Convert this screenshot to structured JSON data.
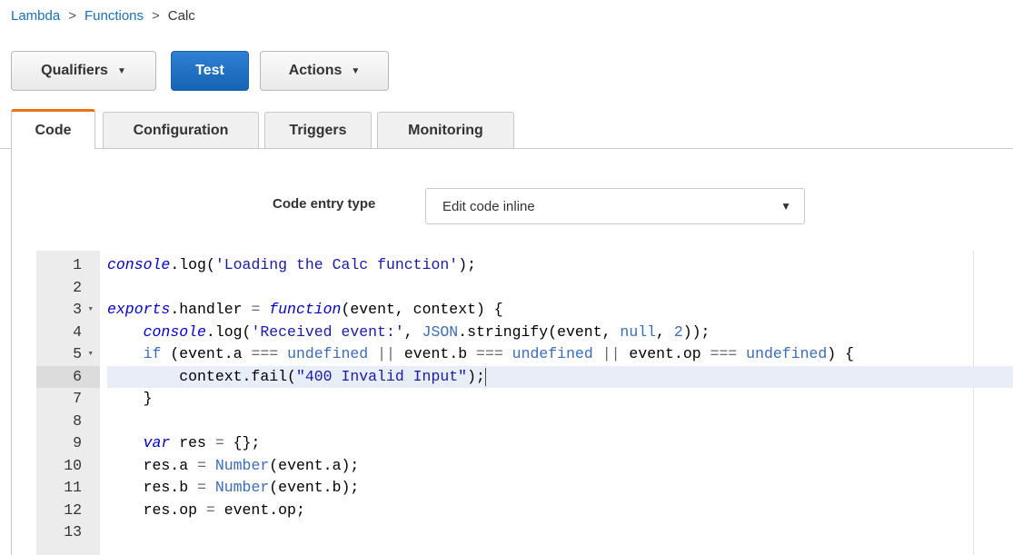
{
  "breadcrumb": {
    "items": [
      "Lambda",
      "Functions"
    ],
    "current": "Calc",
    "separator": ">"
  },
  "toolbar": {
    "qualifiers_label": "Qualifiers",
    "test_label": "Test",
    "actions_label": "Actions"
  },
  "tabs": {
    "code": "Code",
    "configuration": "Configuration",
    "triggers": "Triggers",
    "monitoring": "Monitoring",
    "active": "Code"
  },
  "code_entry": {
    "label": "Code entry type",
    "selected": "Edit code inline"
  },
  "editor": {
    "active_line": 6,
    "lines": [
      {
        "n": "1",
        "fold": false,
        "tokens": [
          [
            "kw",
            "console"
          ],
          [
            "",
            "."
          ],
          [
            "",
            "log"
          ],
          [
            "",
            "("
          ],
          [
            "str",
            "'Loading the Calc function'"
          ],
          [
            "",
            ");"
          ]
        ]
      },
      {
        "n": "2",
        "fold": false,
        "tokens": []
      },
      {
        "n": "3",
        "fold": true,
        "tokens": [
          [
            "kw",
            "exports"
          ],
          [
            "",
            ".handler "
          ],
          [
            "op",
            "="
          ],
          [
            "",
            " "
          ],
          [
            "kw",
            "function"
          ],
          [
            "",
            "(event, context) {"
          ]
        ]
      },
      {
        "n": "4",
        "fold": false,
        "tokens": [
          [
            "",
            "    "
          ],
          [
            "kw",
            "console"
          ],
          [
            "",
            ".log("
          ],
          [
            "str",
            "'Received event:'"
          ],
          [
            "",
            ", "
          ],
          [
            "fn",
            "JSON"
          ],
          [
            "",
            ".stringify(event, "
          ],
          [
            "fn",
            "null"
          ],
          [
            "",
            ", "
          ],
          [
            "fn",
            "2"
          ],
          [
            "",
            "));"
          ]
        ]
      },
      {
        "n": "5",
        "fold": true,
        "tokens": [
          [
            "",
            "    "
          ],
          [
            "fn",
            "if"
          ],
          [
            "",
            " (event.a "
          ],
          [
            "op",
            "==="
          ],
          [
            "",
            " "
          ],
          [
            "fn",
            "undefined"
          ],
          [
            "",
            " "
          ],
          [
            "op",
            "||"
          ],
          [
            "",
            " event.b "
          ],
          [
            "op",
            "==="
          ],
          [
            "",
            " "
          ],
          [
            "fn",
            "undefined"
          ],
          [
            "",
            " "
          ],
          [
            "op",
            "||"
          ],
          [
            "",
            " event.op "
          ],
          [
            "op",
            "==="
          ],
          [
            "",
            " "
          ],
          [
            "fn",
            "undefined"
          ],
          [
            "",
            ") {"
          ]
        ]
      },
      {
        "n": "6",
        "fold": false,
        "tokens": [
          [
            "",
            "        context.fail("
          ],
          [
            "str",
            "\"400 Invalid Input\""
          ],
          [
            "",
            ");"
          ]
        ]
      },
      {
        "n": "7",
        "fold": false,
        "tokens": [
          [
            "",
            "    }"
          ]
        ]
      },
      {
        "n": "8",
        "fold": false,
        "tokens": []
      },
      {
        "n": "9",
        "fold": false,
        "tokens": [
          [
            "",
            "    "
          ],
          [
            "kw",
            "var"
          ],
          [
            "",
            " res "
          ],
          [
            "op",
            "="
          ],
          [
            "",
            " {};"
          ]
        ]
      },
      {
        "n": "10",
        "fold": false,
        "tokens": [
          [
            "",
            "    res.a "
          ],
          [
            "op",
            "="
          ],
          [
            "",
            " "
          ],
          [
            "fn",
            "Number"
          ],
          [
            "",
            "(event.a);"
          ]
        ]
      },
      {
        "n": "11",
        "fold": false,
        "tokens": [
          [
            "",
            "    res.b "
          ],
          [
            "op",
            "="
          ],
          [
            "",
            " "
          ],
          [
            "fn",
            "Number"
          ],
          [
            "",
            "(event.b);"
          ]
        ]
      },
      {
        "n": "12",
        "fold": false,
        "tokens": [
          [
            "",
            "    res.op "
          ],
          [
            "op",
            "="
          ],
          [
            "",
            " event.op;"
          ]
        ]
      },
      {
        "n": "13",
        "fold": false,
        "tokens": []
      }
    ]
  }
}
